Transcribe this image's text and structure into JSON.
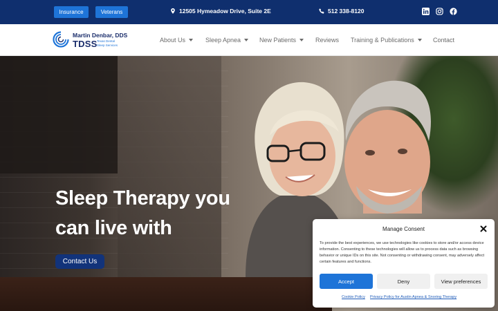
{
  "topbar": {
    "insurance_label": "Insurance",
    "veterans_label": "Veterans",
    "address": "12505 Hymeadow Drive, Suite 2E",
    "phone": "512 338-8120",
    "social_icons": [
      "linkedin-icon",
      "instagram-icon",
      "facebook-icon"
    ]
  },
  "logo": {
    "name": "Martin Denbar, DDS",
    "abbr": "TDSS",
    "subtitle_line1": "Texas Dental",
    "subtitle_line2": "Sleep Services"
  },
  "nav": {
    "items": [
      {
        "label": "About Us",
        "has_dropdown": true
      },
      {
        "label": "Sleep Apnea",
        "has_dropdown": true
      },
      {
        "label": "New Patients",
        "has_dropdown": true
      },
      {
        "label": "Reviews",
        "has_dropdown": false
      },
      {
        "label": "Training & Publications",
        "has_dropdown": true
      },
      {
        "label": "Contact",
        "has_dropdown": false
      }
    ]
  },
  "hero": {
    "title_line1": "Sleep Therapy you",
    "title_line2": "can live with",
    "cta_label": "Contact Us"
  },
  "consent": {
    "title": "Manage Consent",
    "text": "To provide the best experiences, we use technologies like cookies to store and/or access device information. Consenting to these technologies will allow us to process data such as browsing behavior or unique IDs on this site. Not consenting or withdrawing consent, may adversely affect certain features and functions.",
    "accept_label": "Accept",
    "deny_label": "Deny",
    "preferences_label": "View preferences",
    "cookie_policy_label": "Cookie Policy",
    "privacy_policy_label": "Privacy Policy for Austin Apnea & Snoring Therapy"
  },
  "colors": {
    "topbar_bg": "#0f2f6e",
    "accent_blue": "#1e74d8",
    "navy": "#12337a"
  }
}
